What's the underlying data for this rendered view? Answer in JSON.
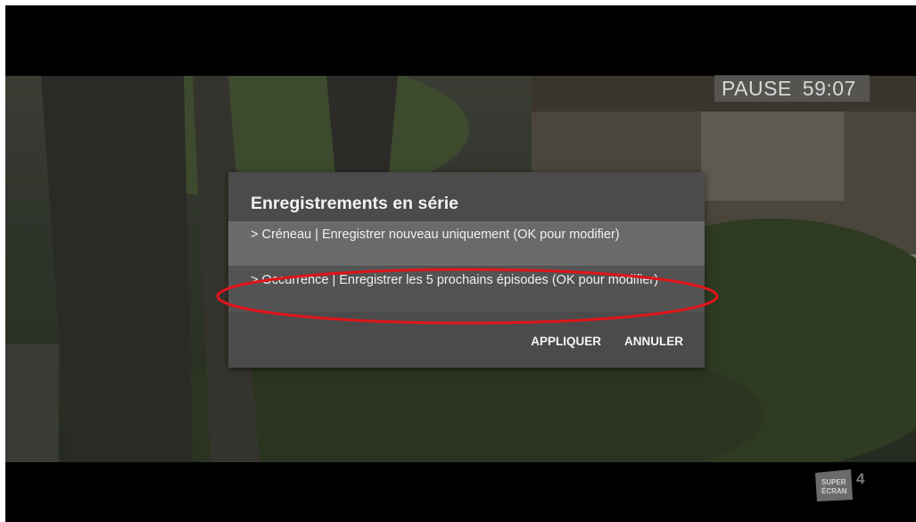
{
  "player": {
    "pause_label": "PAUSE",
    "timestamp": "59:07"
  },
  "dialog": {
    "title": "Enregistrements en série",
    "options": [
      {
        "label": "> Créneau | Enregistrer nouveau uniquement (OK pour modifier)"
      },
      {
        "label": "> Occurrence | Enregistrer les 5 prochains épisodes (OK pour modifier)"
      }
    ],
    "apply_label": "APPLIQUER",
    "cancel_label": "ANNULER"
  },
  "channel": {
    "logo_text_1": "SUPER",
    "logo_text_2": "ÉCRAN",
    "number": "4"
  },
  "colors": {
    "annotation_ellipse": "#e0141a",
    "dialog_bg": "#4b4b4b",
    "selected_option_bg": "#6a6a6a"
  }
}
